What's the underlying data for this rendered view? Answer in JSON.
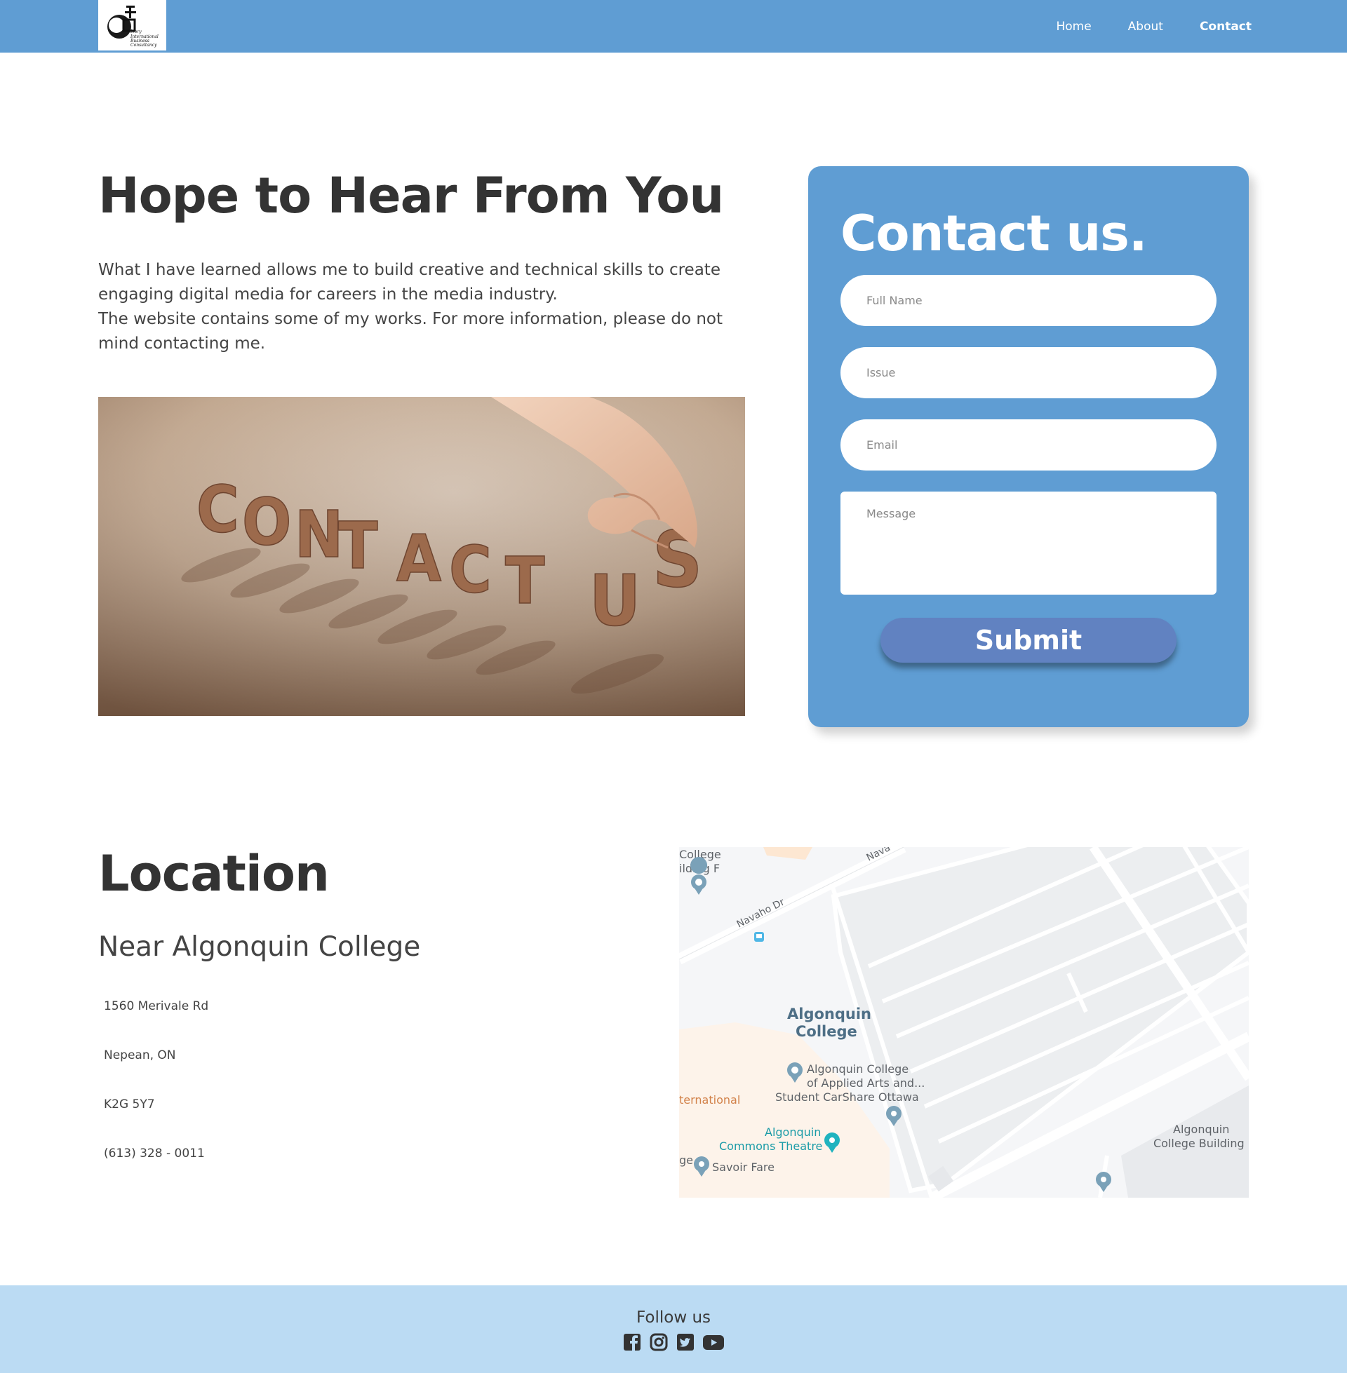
{
  "nav": {
    "logo_lines": [
      "Ivory",
      "International",
      "Business",
      "Consultancy"
    ],
    "links": [
      {
        "label": "Home"
      },
      {
        "label": "About"
      },
      {
        "label": "Contact"
      }
    ]
  },
  "hero": {
    "title": "Hope to Hear From You",
    "paragraph_1": "What I have learned allows me to build creative and technical skills to create engaging digital media for careers in the media industry.",
    "paragraph_2": "The website contains some of my works. For more information, please do not mind contacting me.",
    "image_letters": [
      "C",
      "O",
      "N",
      "T",
      "A",
      "C",
      "T",
      "U",
      "S"
    ]
  },
  "contact_form": {
    "title": "Contact us.",
    "full_name_placeholder": "Full Name",
    "issue_placeholder": "Issue",
    "email_placeholder": "Email",
    "message_placeholder": "Message",
    "submit_label": "Submit"
  },
  "location": {
    "title": "Location",
    "subtitle": "Near Algonquin College",
    "street": "1560 Merivale Rd",
    "city": "Nepean, ON",
    "postal": "K2G 5Y7",
    "phone": "(613) 328 - 0011"
  },
  "map": {
    "labels": {
      "college_top": "College",
      "building_f_top": "ilding F",
      "navaho_dr": "Navaho Dr",
      "navaho_top": "Nava",
      "algonquin_college_1": "Algonquin",
      "algonquin_college_2": "College",
      "applied_arts_1": "Algonquin College",
      "applied_arts_2": "of Applied Arts and...",
      "carshare": "Student CarShare Ottawa",
      "international": "ternational",
      "commons_1": "Algonquin",
      "commons_2": "Commons Theatre",
      "savoir": "Savoir Fare",
      "ge": "ge",
      "building_f_right_1": "Algonquin",
      "building_f_right_2": "College Building F"
    }
  },
  "footer": {
    "follow_label": "Follow us",
    "socials": [
      "facebook-icon",
      "instagram-icon",
      "twitter-icon",
      "youtube-icon"
    ]
  },
  "colors": {
    "nav_blue": "#5f9dd3",
    "card_blue": "#5f9dd3",
    "submit_blue": "#6182c1",
    "footer_blue": "#bbdbf3",
    "heading_dark": "#333333"
  }
}
